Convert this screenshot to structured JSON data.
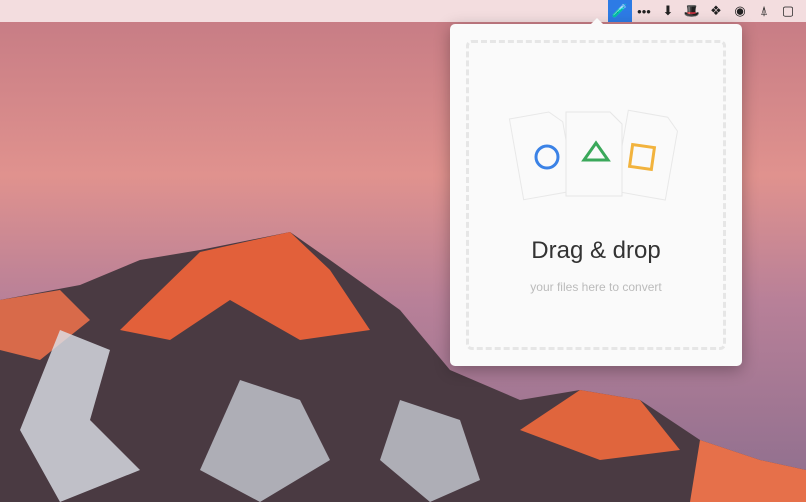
{
  "menubar": {
    "icons": [
      "converter-app-icon",
      "more-dots-icon",
      "download-box-icon",
      "hat-icon",
      "dropbox-icon",
      "sync-icon",
      "broom-icon",
      "square-icon"
    ],
    "more": "•••"
  },
  "popover": {
    "title": "Drag & drop",
    "subtitle": "your files here to convert"
  },
  "colors": {
    "circle": "#3b82e6",
    "triangle": "#3aa85a",
    "square": "#f2b33d",
    "accent": "#2d7be5"
  }
}
